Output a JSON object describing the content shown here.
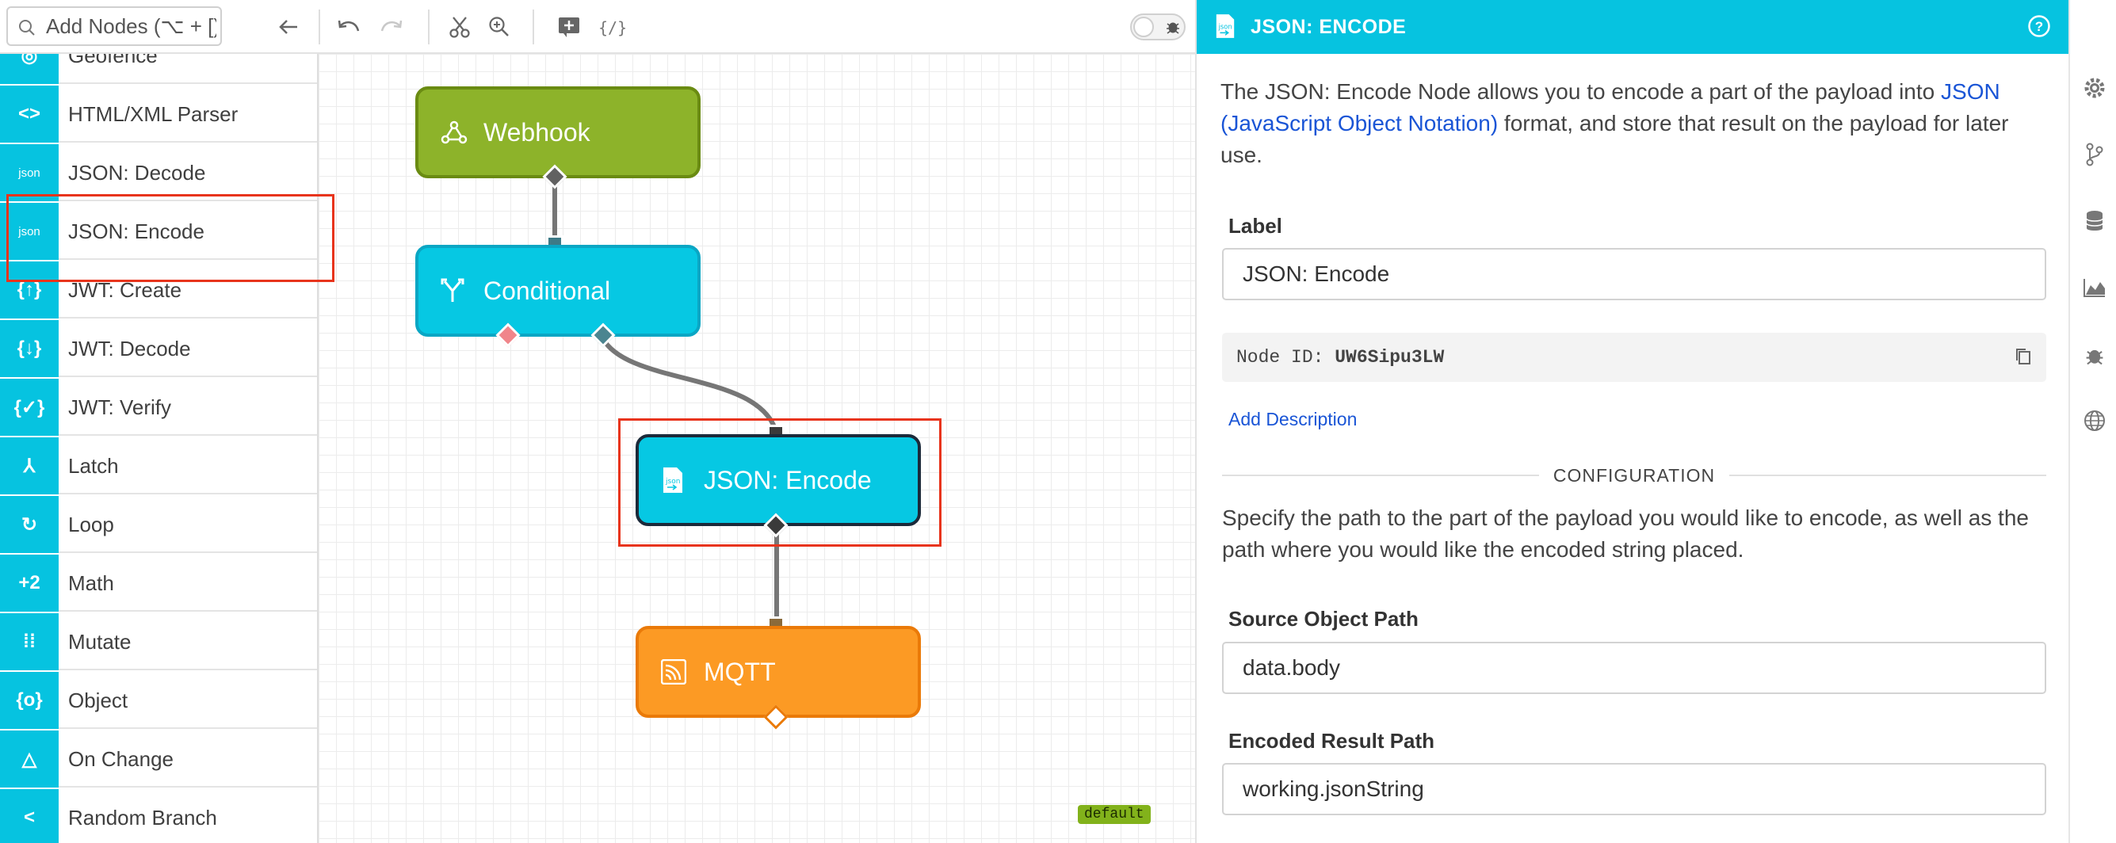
{
  "toolbar": {
    "search_placeholder": "Add Nodes (⌥ + [)",
    "debug_toggle_on": false
  },
  "palette": {
    "items": [
      {
        "label": "Geofence",
        "icon": "geofence-icon",
        "glyph": "◎"
      },
      {
        "label": "HTML/XML Parser",
        "icon": "code-brackets-icon",
        "glyph": "<>"
      },
      {
        "label": "JSON: Decode",
        "icon": "json-file-icon",
        "glyph": "json"
      },
      {
        "label": "JSON: Encode",
        "icon": "json-file-icon",
        "glyph": "json"
      },
      {
        "label": "JWT: Create",
        "icon": "jwt-icon",
        "glyph": "{↑}"
      },
      {
        "label": "JWT: Decode",
        "icon": "jwt-icon",
        "glyph": "{↓}"
      },
      {
        "label": "JWT: Verify",
        "icon": "jwt-icon",
        "glyph": "{✓}"
      },
      {
        "label": "Latch",
        "icon": "latch-icon",
        "glyph": "⅄"
      },
      {
        "label": "Loop",
        "icon": "loop-icon",
        "glyph": "↻"
      },
      {
        "label": "Math",
        "icon": "math-icon",
        "glyph": "+2"
      },
      {
        "label": "Mutate",
        "icon": "mutate-icon",
        "glyph": "⁞⁞"
      },
      {
        "label": "Object",
        "icon": "object-icon",
        "glyph": "{o}"
      },
      {
        "label": "On Change",
        "icon": "triangle-icon",
        "glyph": "△"
      },
      {
        "label": "Random Branch",
        "icon": "share-icon",
        "glyph": "<"
      }
    ]
  },
  "canvas": {
    "nodes": [
      {
        "label": "Webhook",
        "color": "#8db32a",
        "border": "#6a8b12",
        "icon": "webhook-icon"
      },
      {
        "label": "Conditional",
        "color": "#06c8e3",
        "border": "#0aa6c4",
        "icon": "fork-icon"
      },
      {
        "label": "JSON: Encode",
        "color": "#06c8e3",
        "border": "#1c2a3a",
        "icon": "json-file-icon"
      },
      {
        "label": "MQTT",
        "color": "#fc9a24",
        "border": "#ea7a08",
        "icon": "rss-icon"
      }
    ],
    "badge": "default"
  },
  "panel": {
    "title": "JSON: ENCODE",
    "intro_before": "The JSON: Encode Node allows you to encode a part of the payload into ",
    "intro_link": "JSON (JavaScript Object Notation)",
    "intro_after": " format, and store that result on the payload for later use.",
    "label_title": "Label",
    "label_value": "JSON: Encode",
    "node_id_prefix": "Node ID:",
    "node_id": "UW6Sipu3LW",
    "add_description": "Add Description",
    "section": "CONFIGURATION",
    "config_description": "Specify the path to the part of the payload you would like to encode, as well as the path where you would like the encoded string placed.",
    "source_label": "Source Object Path",
    "source_value": "data.body",
    "result_label": "Encoded Result Path",
    "result_value": "working.jsonString"
  },
  "colors": {
    "accent": "#06c3e0",
    "link": "#1a55d6",
    "highlight": "#e8341c"
  }
}
